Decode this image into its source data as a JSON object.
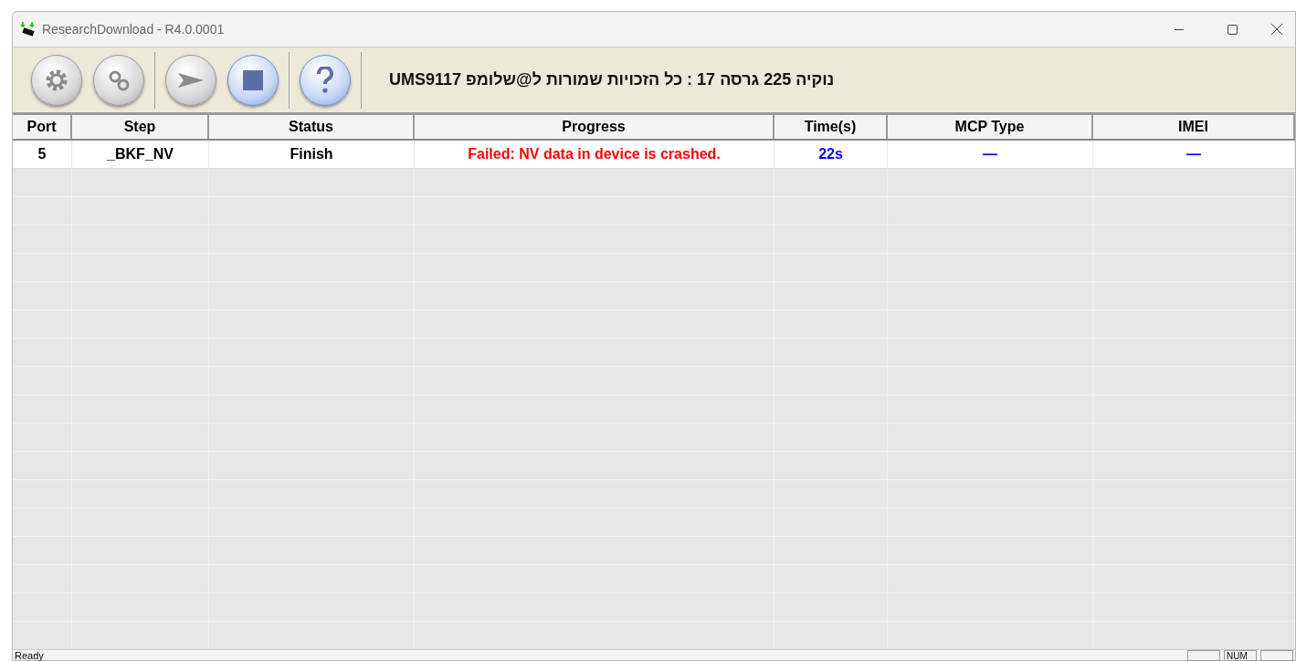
{
  "window": {
    "title": "ResearchDownload - R4.0.0001"
  },
  "toolbar": {
    "buttons": [
      {
        "kind": "settings",
        "disabled": true
      },
      {
        "kind": "gears",
        "disabled": true
      },
      {
        "kind": "start",
        "disabled": true
      },
      {
        "kind": "stop",
        "disabled": false
      },
      {
        "kind": "help",
        "disabled": false
      }
    ],
    "banner": "נוקיה 225 גרסה 17 : כל הזכויות שמורות ל@שלומפ UMS9117"
  },
  "table": {
    "columns": [
      "Port",
      "Step",
      "Status",
      "Progress",
      "Time(s)",
      "MCP Type",
      "IMEI"
    ],
    "rows": [
      {
        "port": "5",
        "step": "_BKF_NV",
        "status": "Finish",
        "progress": "Failed: NV data in device is crashed.",
        "time": "22s",
        "mcp_type": "—",
        "imei": "—"
      }
    ]
  },
  "status_bar": {
    "text": "Ready",
    "num_pane": "NUM"
  }
}
